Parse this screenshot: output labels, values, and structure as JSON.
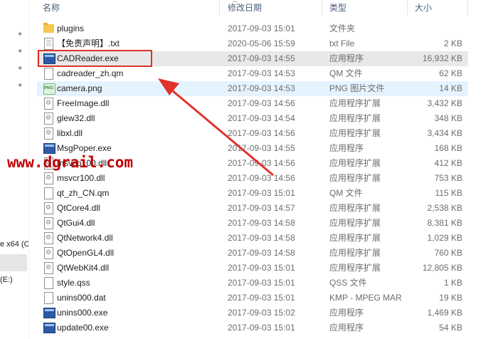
{
  "header": {
    "name": "名称",
    "date": "修改日期",
    "type": "类型",
    "size": "大小"
  },
  "nav": {
    "text_x64": "e x64 (C",
    "text_drive": "(E:)"
  },
  "watermark": "www.dgrail.com",
  "files": [
    {
      "name": "plugins",
      "date": "2017-09-03 15:01",
      "type": "文件夹",
      "size": "",
      "icon": "folder-icon"
    },
    {
      "name": "【免责声明】.txt",
      "date": "2020-05-06 15:59",
      "type": "txt File",
      "size": "2 KB",
      "icon": "text-file-icon"
    },
    {
      "name": "CADReader.exe",
      "date": "2017-09-03 14:55",
      "type": "应用程序",
      "size": "16,932 KB",
      "icon": "application-icon"
    },
    {
      "name": "cadreader_zh.qm",
      "date": "2017-09-03 14:53",
      "type": "QM 文件",
      "size": "62 KB",
      "icon": "file-icon"
    },
    {
      "name": "camera.png",
      "date": "2017-09-03 14:53",
      "type": "PNG 图片文件",
      "size": "14 KB",
      "icon": "image-file-icon"
    },
    {
      "name": "FreeImage.dll",
      "date": "2017-09-03 14:56",
      "type": "应用程序扩展",
      "size": "3,432 KB",
      "icon": "dll-file-icon"
    },
    {
      "name": "glew32.dll",
      "date": "2017-09-03 14:54",
      "type": "应用程序扩展",
      "size": "348 KB",
      "icon": "dll-file-icon"
    },
    {
      "name": "libxl.dll",
      "date": "2017-09-03 14:56",
      "type": "应用程序扩展",
      "size": "3,434 KB",
      "icon": "dll-file-icon"
    },
    {
      "name": "MsgPoper.exe",
      "date": "2017-09-03 14:55",
      "type": "应用程序",
      "size": "168 KB",
      "icon": "application-icon"
    },
    {
      "name": "msvcp100.dll",
      "date": "2017-09-03 14:56",
      "type": "应用程序扩展",
      "size": "412 KB",
      "icon": "dll-file-icon"
    },
    {
      "name": "msvcr100.dll",
      "date": "2017-09-03 14:56",
      "type": "应用程序扩展",
      "size": "753 KB",
      "icon": "dll-file-icon"
    },
    {
      "name": "qt_zh_CN.qm",
      "date": "2017-09-03 15:01",
      "type": "QM 文件",
      "size": "115 KB",
      "icon": "file-icon"
    },
    {
      "name": "QtCore4.dll",
      "date": "2017-09-03 14:57",
      "type": "应用程序扩展",
      "size": "2,538 KB",
      "icon": "dll-file-icon"
    },
    {
      "name": "QtGui4.dll",
      "date": "2017-09-03 14:58",
      "type": "应用程序扩展",
      "size": "8,381 KB",
      "icon": "dll-file-icon"
    },
    {
      "name": "QtNetwork4.dll",
      "date": "2017-09-03 14:58",
      "type": "应用程序扩展",
      "size": "1,029 KB",
      "icon": "dll-file-icon"
    },
    {
      "name": "QtOpenGL4.dll",
      "date": "2017-09-03 14:58",
      "type": "应用程序扩展",
      "size": "760 KB",
      "icon": "dll-file-icon"
    },
    {
      "name": "QtWebKit4.dll",
      "date": "2017-09-03 15:01",
      "type": "应用程序扩展",
      "size": "12,805 KB",
      "icon": "dll-file-icon"
    },
    {
      "name": "style.qss",
      "date": "2017-09-03 15:01",
      "type": "QSS 文件",
      "size": "1 KB",
      "icon": "file-icon"
    },
    {
      "name": "unins000.dat",
      "date": "2017-09-03 15:01",
      "type": "KMP - MPEG MAR",
      "size": "19 KB",
      "icon": "file-icon"
    },
    {
      "name": "unins000.exe",
      "date": "2017-09-03 15:02",
      "type": "应用程序",
      "size": "1,469 KB",
      "icon": "application-icon"
    },
    {
      "name": "update00.exe",
      "date": "2017-09-03 15:01",
      "type": "应用程序",
      "size": "54 KB",
      "icon": "application-icon"
    }
  ],
  "colors": {
    "highlight_border": "#e2312b",
    "arrow": "#e2312b",
    "watermark": "#c00000",
    "row_hover": "#e8e8e8",
    "row_selected": "#e5f3ff"
  }
}
